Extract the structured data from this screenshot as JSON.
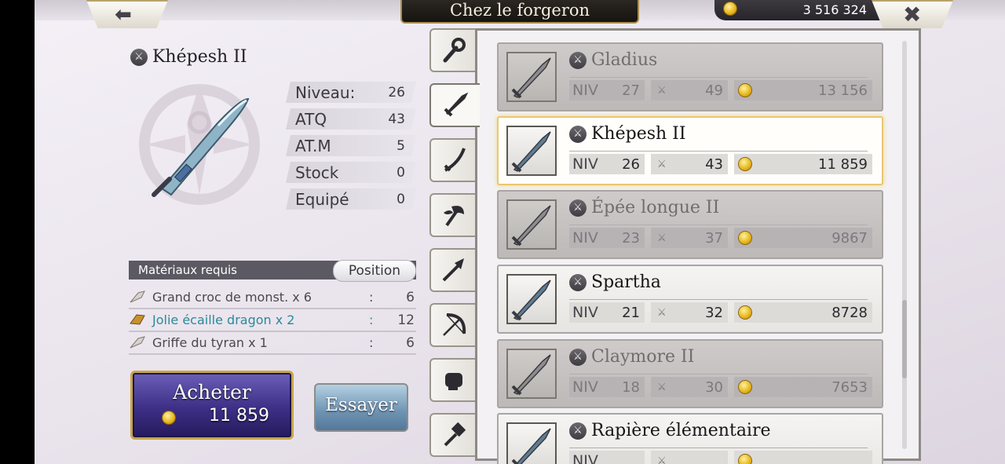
{
  "header": {
    "title": "Chez le forgeron",
    "gold": "3 516 324",
    "back_icon": "arrow-left-icon",
    "close_icon": "close-icon"
  },
  "item": {
    "name": "Khépesh II",
    "stats": [
      {
        "label": "Niveau:",
        "value": "26"
      },
      {
        "label": "ATQ",
        "value": "43"
      },
      {
        "label": "AT.M",
        "value": "5"
      },
      {
        "label": "Stock",
        "value": "0"
      },
      {
        "label": "Equipé",
        "value": "0"
      }
    ]
  },
  "materials": {
    "header": "Matériaux requis",
    "position_label": "Position",
    "items": [
      {
        "name": "Grand croc de monst. x 6",
        "sep": ":",
        "qty": "6"
      },
      {
        "name": "Jolie écaille dragon x 2",
        "sep": ":",
        "qty": "12"
      },
      {
        "name": "Griffe du tyran x 1",
        "sep": ":",
        "qty": "6"
      }
    ]
  },
  "actions": {
    "buy_label": "Acheter",
    "buy_price": "11 859",
    "try_label": "Essayer"
  },
  "tabs": [
    "staff-icon",
    "sword-icon",
    "katana-icon",
    "axe-icon",
    "spear-icon",
    "bow-icon",
    "fist-icon",
    "hammer-icon"
  ],
  "list_labels": {
    "level": "NIV"
  },
  "weapons": [
    {
      "name": "Gladius",
      "level": "27",
      "atk": "49",
      "price": "13 156",
      "state": "locked"
    },
    {
      "name": "Khépesh II",
      "level": "26",
      "atk": "43",
      "price": "11 859",
      "state": "selected"
    },
    {
      "name": "Épée longue II",
      "level": "23",
      "atk": "37",
      "price": "9867",
      "state": "locked"
    },
    {
      "name": "Spartha",
      "level": "21",
      "atk": "32",
      "price": "8728",
      "state": "available"
    },
    {
      "name": "Claymore II",
      "level": "18",
      "atk": "30",
      "price": "7653",
      "state": "locked"
    },
    {
      "name": "Rapière élémentaire",
      "level": "",
      "atk": "",
      "price": "",
      "state": "available"
    }
  ]
}
